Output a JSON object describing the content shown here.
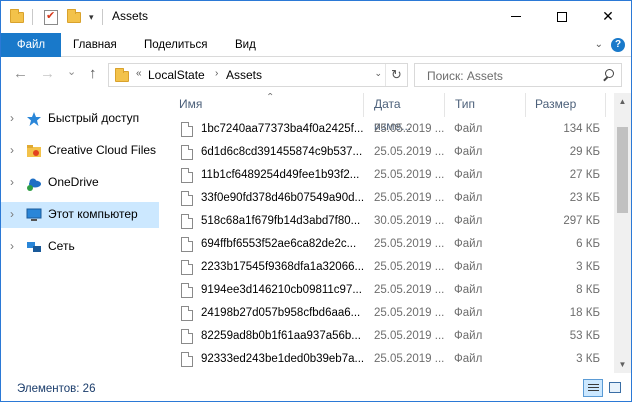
{
  "window": {
    "title": "Assets",
    "controls": {
      "minimize": "",
      "maximize": "",
      "close": "✕"
    }
  },
  "ribbon": {
    "tabs": [
      "Файл",
      "Главная",
      "Поделиться",
      "Вид"
    ],
    "help": "?"
  },
  "nav": {
    "back": "←",
    "forward": "→",
    "recent": "⌄",
    "up": "↑",
    "breadcrumb_overflow": "«",
    "breadcrumb": [
      "LocalState",
      "Assets"
    ],
    "refresh": "↻"
  },
  "search": {
    "placeholder": "Поиск: Assets"
  },
  "sidebar": {
    "items": [
      {
        "label": "Быстрый доступ",
        "icon": "star-icon"
      },
      {
        "label": "Creative Cloud Files",
        "icon": "folder-icon"
      },
      {
        "label": "OneDrive",
        "icon": "cloud-icon"
      },
      {
        "label": "Этот компьютер",
        "icon": "computer-icon",
        "selected": true
      },
      {
        "label": "Сеть",
        "icon": "network-icon"
      }
    ]
  },
  "columns": {
    "name": "Имя",
    "date": "Дата изме...",
    "type": "Тип",
    "size": "Размер"
  },
  "files": [
    {
      "name": "1bc7240aa77373ba4f0a2425f...",
      "date": "25.05.2019 ...",
      "type": "Файл",
      "size": "134 КБ"
    },
    {
      "name": "6d1d6c8cd391455874c9b537...",
      "date": "25.05.2019 ...",
      "type": "Файл",
      "size": "29 КБ"
    },
    {
      "name": "11b1cf6489254d49fee1b93f2...",
      "date": "25.05.2019 ...",
      "type": "Файл",
      "size": "27 КБ"
    },
    {
      "name": "33f0e90fd378d46b07549a90d...",
      "date": "25.05.2019 ...",
      "type": "Файл",
      "size": "23 КБ"
    },
    {
      "name": "518c68a1f679fb14d3abd7f80...",
      "date": "30.05.2019 ...",
      "type": "Файл",
      "size": "297 КБ"
    },
    {
      "name": "694ffbf6553f52ae6ca82de2c...",
      "date": "25.05.2019 ...",
      "type": "Файл",
      "size": "6 КБ"
    },
    {
      "name": "2233b17545f9368dfa1a32066...",
      "date": "25.05.2019 ...",
      "type": "Файл",
      "size": "3 КБ"
    },
    {
      "name": "9194ee3d146210cb09811c97...",
      "date": "25.05.2019 ...",
      "type": "Файл",
      "size": "8 КБ"
    },
    {
      "name": "24198b27d057b958cfbd6aa6...",
      "date": "25.05.2019 ...",
      "type": "Файл",
      "size": "18 КБ"
    },
    {
      "name": "82259ad8b0b1f61aa937a56b...",
      "date": "25.05.2019 ...",
      "type": "Файл",
      "size": "53 КБ"
    },
    {
      "name": "92333ed243be1ded0b39eb7a...",
      "date": "25.05.2019 ...",
      "type": "Файл",
      "size": "3 КБ"
    }
  ],
  "status": {
    "count": "Элементов: 26"
  },
  "colors": {
    "accent": "#1979ca",
    "selection": "#cce8ff",
    "header_text": "#4c607a",
    "folder": "#f3c24a"
  }
}
